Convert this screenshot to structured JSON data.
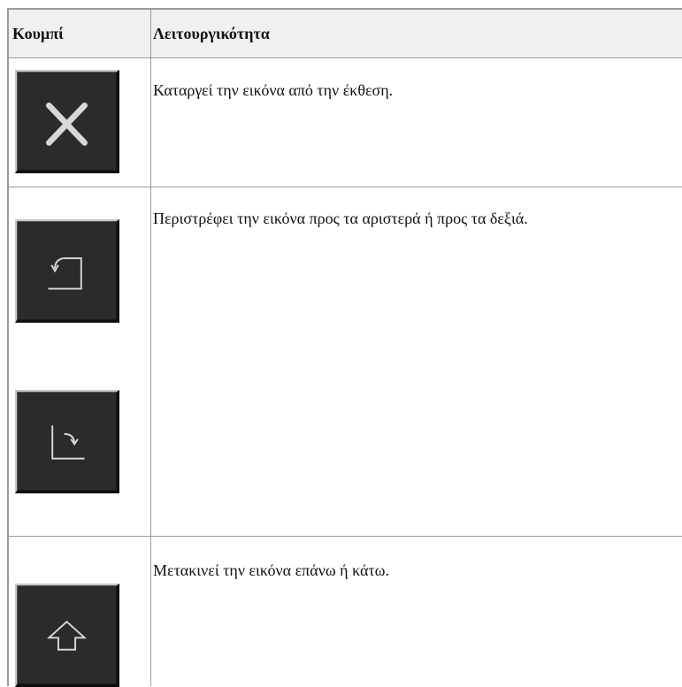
{
  "table": {
    "headers": [
      "Κουμπί",
      "Λειτουργικότητα"
    ],
    "rows": [
      {
        "button_icons": [
          "close-icon"
        ],
        "description": "Καταργεί την εικόνα από την έκθεση."
      },
      {
        "button_icons": [
          "rotate-left-icon",
          "rotate-right-icon"
        ],
        "description": "Περιστρέφει την εικόνα προς τα αριστερά ή προς τα δεξιά."
      },
      {
        "button_icons": [
          "arrow-up-icon"
        ],
        "description": "Μετακινεί την εικόνα επάνω ή κάτω."
      }
    ]
  },
  "colors": {
    "button_face": "#2b2b2b",
    "icon": "#d8d8d8",
    "header_bg": "#f0f0f0",
    "grid": "#9a9a9a"
  }
}
